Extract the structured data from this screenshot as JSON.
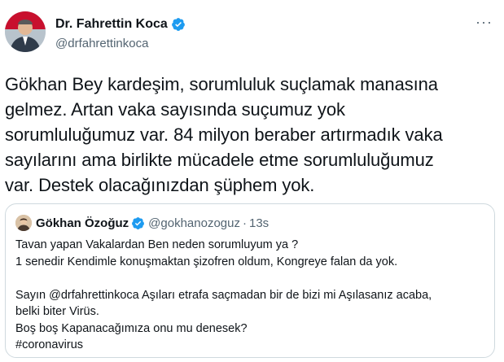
{
  "author": {
    "display_name": "Dr. Fahrettin Koca",
    "handle": "@drfahrettinkoca",
    "verified": true,
    "avatar": "profile-photo"
  },
  "tweet": {
    "text": "Gökhan Bey kardeşim, sorumluluk suçlamak manasına\ngelmez. Artan vaka sayısında suçumuz yok\nsorumluluğumuz var. 84 milyon beraber artırmadık vaka\nsayılarını ama birlikte mücadele etme sorumluluğumuz\nvar. Destek olacağınızdan şüphem yok.",
    "more_icon": "more-options-icon",
    "more_label": "···"
  },
  "quoted": {
    "display_name": "Gökhan Özoğuz",
    "handle": "@gokhanozoguz",
    "separator": "·",
    "time": "13s",
    "verified": true,
    "text": "Tavan yapan Vakalardan Ben neden sorumluyum ya ?\n1 senedir Kendimle konuşmaktan şizofren oldum, Kongreye falan da yok.\n\nSayın @drfahrettinkoca Aşıları etrafa saçmadan bir de bizi mi Aşılasanız acaba,\nbelki biter Virüs.\nBoş boş Kapanacağımıza onu mu denesek?\n#coronavirus"
  },
  "colors": {
    "verified_blue": "#1d9bf0",
    "border": "#cfd9de",
    "muted": "#536471",
    "text": "#0f1419"
  }
}
